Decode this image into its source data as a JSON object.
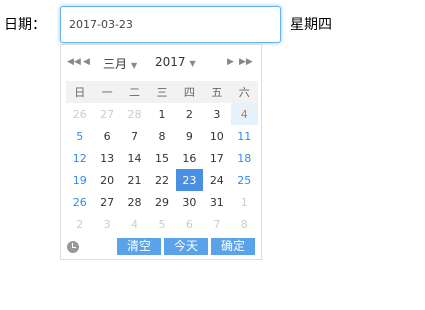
{
  "form": {
    "date_label": "日期：",
    "date_value": "2017-03-23",
    "weekday_text": "星期四"
  },
  "picker": {
    "month": "三月",
    "year": "2017",
    "weekdays": [
      "日",
      "一",
      "二",
      "三",
      "四",
      "五",
      "六"
    ],
    "weeks": [
      [
        "26",
        "27",
        "28",
        "1",
        "2",
        "3",
        "4"
      ],
      [
        "5",
        "6",
        "7",
        "8",
        "9",
        "10",
        "11"
      ],
      [
        "12",
        "13",
        "14",
        "15",
        "16",
        "17",
        "18"
      ],
      [
        "19",
        "20",
        "21",
        "22",
        "23",
        "24",
        "25"
      ],
      [
        "26",
        "27",
        "28",
        "29",
        "30",
        "31",
        "1"
      ],
      [
        "2",
        "3",
        "4",
        "5",
        "6",
        "7",
        "8"
      ]
    ],
    "clear_label": "清空",
    "today_label": "今天",
    "ok_label": "确定"
  },
  "colors": {
    "accent": "#4a90e2",
    "weekend": "#2d8cf0",
    "today_text": "#ff6600",
    "button_bg": "#5aa3ea"
  }
}
